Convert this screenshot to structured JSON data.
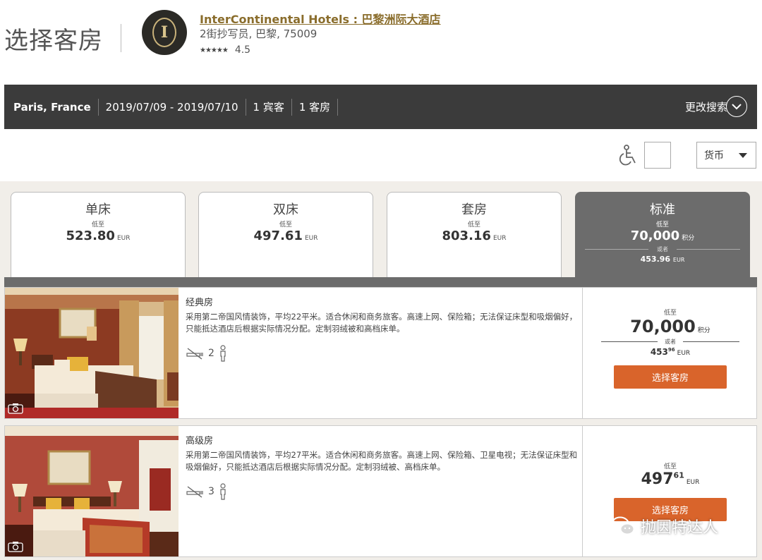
{
  "header": {
    "page_title": "选择客房",
    "hotel_name": "InterContinental Hotels : 巴黎洲际大酒店",
    "hotel_address": "2街抄写员, 巴黎, 75009",
    "rating": "4.5",
    "logo_letter": "I"
  },
  "search_bar": {
    "city": "Paris, France",
    "dates": "2019/07/09 - 2019/07/10",
    "guests": "1 宾客",
    "rooms": "1 客房",
    "change_label": "更改搜索"
  },
  "filters": {
    "currency_label": "货币"
  },
  "tabs": [
    {
      "name": "单床",
      "low": "低至",
      "price": "523.80",
      "unit": "EUR"
    },
    {
      "name": "双床",
      "low": "低至",
      "price": "497.61",
      "unit": "EUR"
    },
    {
      "name": "套房",
      "low": "低至",
      "price": "803.16",
      "unit": "EUR"
    },
    {
      "name": "标准",
      "low": "低至",
      "price": "70,000",
      "unit": "积分",
      "or": "或者",
      "alt_price": "453.96",
      "alt_unit": "EUR"
    }
  ],
  "rooms": [
    {
      "name": "经典房",
      "desc": "采用第二帝国风情装饰，平均22平米。适合休闲和商务旅客。高速上网、保险箱；无法保证床型和吸烟偏好，只能抵达酒店后根据实际情况分配。定制羽绒被和高档床单。",
      "occupancy": "2",
      "low": "低至",
      "points": "70,000",
      "points_unit": "积分",
      "or": "或者",
      "cash_main": "453",
      "cash_cents": "96",
      "cash_unit": "EUR",
      "button": "选择客房"
    },
    {
      "name": "高级房",
      "desc": "采用第二帝国风情装饰，平均27平米。适合休闲和商务旅客。高速上网、保险箱、卫星电视；无法保证床型和吸烟偏好，只能抵达酒店后根据实际情况分配。定制羽绒被、高档床单。",
      "occupancy": "3",
      "low": "低至",
      "price_main": "497",
      "price_cents": "61",
      "price_unit": "EUR",
      "button": "选择客房"
    }
  ],
  "watermark": "抛因特达人",
  "colors": {
    "accent_orange": "#d9642b",
    "bar_dark": "#3b3b3b",
    "tab_active": "#6c6c6c",
    "brand_gold": "#8a6d2c"
  }
}
